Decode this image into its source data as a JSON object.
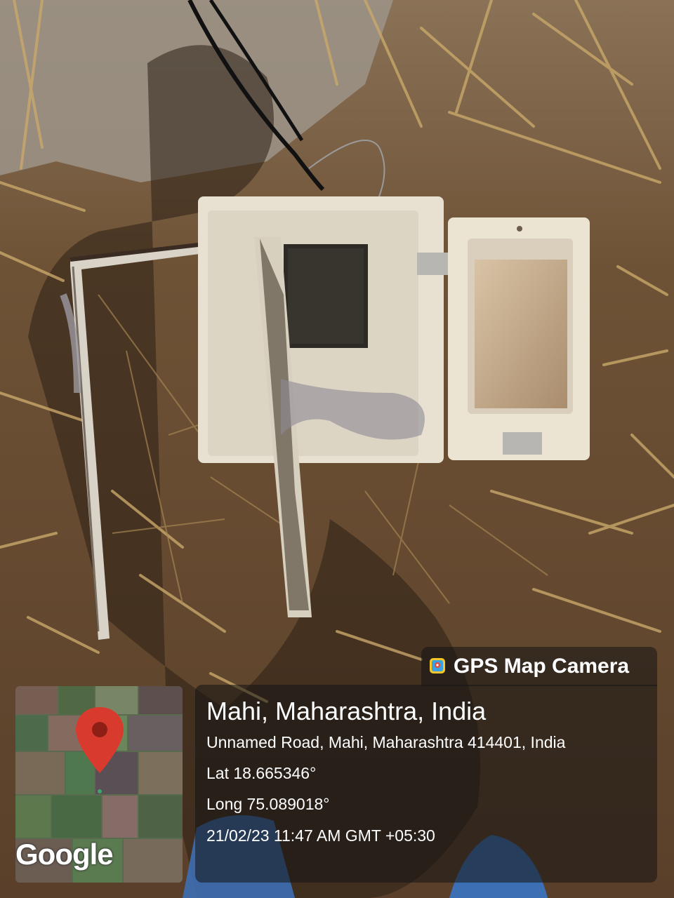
{
  "badge": {
    "app_name": "GPS Map Camera",
    "icon": "gps-camera-app-icon"
  },
  "location": {
    "title": "Mahi, Maharashtra, India",
    "address": "Unnamed Road, Mahi, Maharashtra 414401, India",
    "lat": "Lat 18.665346°",
    "long": "Long 75.089018°",
    "datetime": "21/02/23 11:47 AM GMT +05:30"
  },
  "map": {
    "provider": "Google",
    "marker_icon": "map-pin-icon",
    "marker_color": "#d93a2e"
  },
  "colors": {
    "soil": "#6b5134",
    "overlay": "#141414"
  }
}
